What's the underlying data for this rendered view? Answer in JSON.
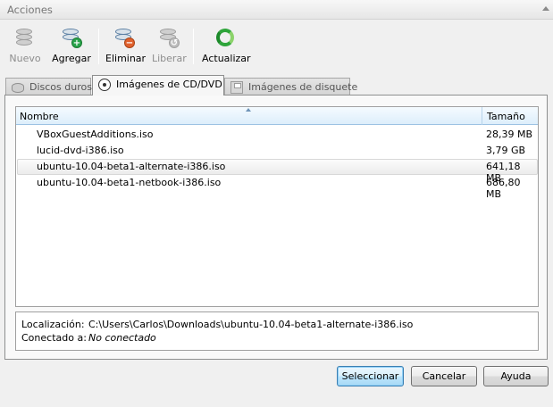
{
  "title": "Acciones",
  "toolbar": {
    "new": "Nuevo",
    "add": "Agregar",
    "remove": "Eliminar",
    "release": "Liberar",
    "refresh": "Actualizar"
  },
  "tabs": [
    {
      "label": "Discos duros"
    },
    {
      "label": "Imágenes de CD/DVD"
    },
    {
      "label": "Imágenes de disquete"
    }
  ],
  "list": {
    "columns": {
      "name": "Nombre",
      "size": "Tamaño"
    },
    "rows": [
      {
        "name": "VBoxGuestAdditions.iso",
        "size": "28,39 MB"
      },
      {
        "name": "lucid-dvd-i386.iso",
        "size": "3,79 GB"
      },
      {
        "name": "ubuntu-10.04-beta1-alternate-i386.iso",
        "size": "641,18 MB"
      },
      {
        "name": "ubuntu-10.04-beta1-netbook-i386.iso",
        "size": "686,80 MB"
      }
    ]
  },
  "info": {
    "location_label": "Localización:",
    "location_value": "C:\\Users\\Carlos\\Downloads\\ubuntu-10.04-beta1-alternate-i386.iso",
    "attached_label": "Conectado a:",
    "attached_value": "No conectado"
  },
  "buttons": {
    "select": "Seleccionar",
    "cancel": "Cancelar",
    "help": "Ayuda"
  },
  "colors": {
    "accent": "#3c7fb1",
    "refresh_green": "#2ea53a"
  }
}
